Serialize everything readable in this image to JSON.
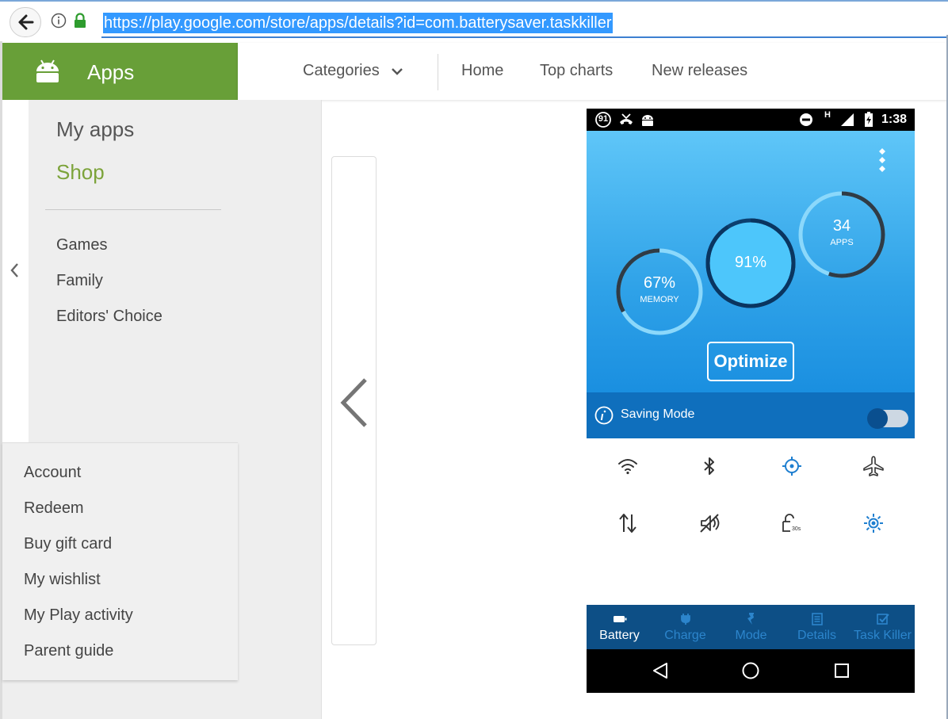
{
  "browser": {
    "url": "https://play.google.com/store/apps/details?id=com.batterysaver.taskkiller"
  },
  "header": {
    "section_title": "Apps",
    "nav": [
      "Categories",
      "Home",
      "Top charts",
      "New releases"
    ]
  },
  "sidebar": {
    "primary": [
      "My apps",
      "Shop"
    ],
    "categories": [
      "Games",
      "Family",
      "Editors' Choice"
    ],
    "account": [
      "Account",
      "Redeem",
      "Buy gift card",
      "My wishlist",
      "My Play activity",
      "Parent guide"
    ]
  },
  "phone": {
    "status_badge": "91",
    "status_network": "H",
    "time": "1:38",
    "gauges": {
      "memory": {
        "value": "67%",
        "label": "MEMORY",
        "fraction": 0.67
      },
      "battery": {
        "value": "91%",
        "fraction": 0.91
      },
      "apps": {
        "value": "34",
        "label": "APPS",
        "fraction": 0.55
      }
    },
    "optimize_label": "Optimize",
    "saving_mode_label": "Saving Mode",
    "saving_mode_on": true,
    "quick_icons": [
      "wifi-icon",
      "bluetooth-icon",
      "gps-icon",
      "airplane-icon",
      "data-icon",
      "sound-off-icon",
      "screen-timeout-icon",
      "brightness-icon"
    ],
    "timeout_label": "30s",
    "tabs": [
      {
        "label": "Battery",
        "icon": "battery-icon",
        "active": true
      },
      {
        "label": "Charge",
        "icon": "plug-icon",
        "active": false
      },
      {
        "label": "Mode",
        "icon": "bolt-icon",
        "active": false
      },
      {
        "label": "Details",
        "icon": "list-icon",
        "active": false
      },
      {
        "label": "Task Killer",
        "icon": "check-icon",
        "active": false
      }
    ]
  },
  "colors": {
    "play_green": "#689f38",
    "shop_green": "#7ca33a",
    "hero_blue": "#2fa2e8",
    "tab_bar": "#0d4f86"
  }
}
